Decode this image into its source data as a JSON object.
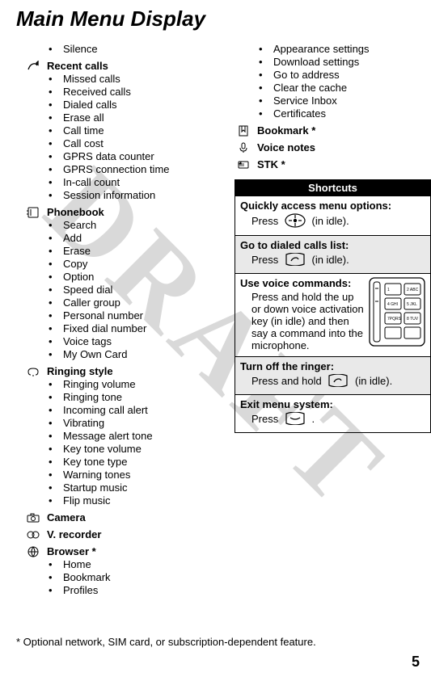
{
  "watermark": "DRAFT",
  "title": "Main Menu Display",
  "left_top_bullet": "Silence",
  "sections_left": [
    {
      "icon": "recent-calls-icon",
      "label": "Recent calls",
      "items": [
        "Missed calls",
        "Received calls",
        "Dialed calls",
        "Erase all",
        "Call time",
        "Call cost",
        "GPRS data counter",
        "GPRS connection time",
        "In-call count",
        "Session information"
      ]
    },
    {
      "icon": "phonebook-icon",
      "label": "Phonebook",
      "items": [
        "Search",
        "Add",
        "Erase",
        "Copy",
        "Option",
        "Speed dial",
        "Caller group",
        "Personal number",
        "Fixed dial number",
        "Voice tags",
        "My Own Card"
      ]
    },
    {
      "icon": "ringing-icon",
      "label": "Ringing style",
      "items": [
        "Ringing volume",
        "Ringing tone",
        "Incoming call alert",
        "Vibrating",
        "Message alert tone",
        "Key tone volume",
        "Key tone type",
        "Warning tones",
        "Startup music",
        "Flip music"
      ]
    },
    {
      "icon": "camera-icon",
      "label": "Camera",
      "items": []
    },
    {
      "icon": "vrecorder-icon",
      "label": "V. recorder",
      "items": []
    },
    {
      "icon": "browser-icon",
      "label": "Browser *",
      "items": [
        "Home",
        "Bookmark",
        "Profiles"
      ]
    }
  ],
  "right_top_bullets": [
    "Appearance settings",
    "Download settings",
    "Go to address",
    "Clear the cache",
    "Service Inbox",
    "Certificates"
  ],
  "sections_right": [
    {
      "icon": "bookmark-icon",
      "label": "Bookmark *"
    },
    {
      "icon": "voice-notes-icon",
      "label": "Voice notes"
    },
    {
      "icon": "stk-icon",
      "label": "STK *"
    }
  ],
  "shortcuts": {
    "header": "Shortcuts",
    "s1_title": "Quickly access menu options:",
    "s1_press": "Press",
    "s1_tail": "(in idle).",
    "s2_title": "Go to dialed calls list:",
    "s2_press": "Press",
    "s2_tail": "(in idle).",
    "s3_title": "Use voice commands:",
    "s3_body": "Press and hold the up or down voice activation key (in idle) and then say a command into the microphone.",
    "s4_title": "Turn off the ringer:",
    "s4_press": "Press and hold",
    "s4_tail": "(in idle).",
    "s5_title": "Exit menu system:",
    "s5_press": "Press",
    "s5_tail": "."
  },
  "footnote": "* Optional network, SIM card, or subscription-dependent feature.",
  "page_number": "5"
}
